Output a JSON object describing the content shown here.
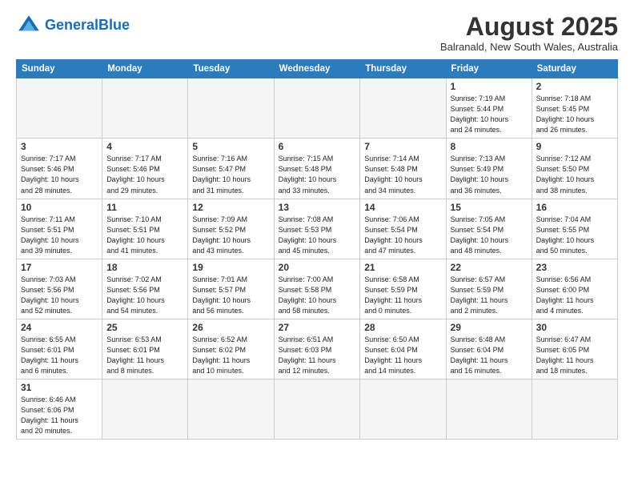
{
  "header": {
    "logo_general": "General",
    "logo_blue": "Blue",
    "month_year": "August 2025",
    "location": "Balranald, New South Wales, Australia"
  },
  "weekdays": [
    "Sunday",
    "Monday",
    "Tuesday",
    "Wednesday",
    "Thursday",
    "Friday",
    "Saturday"
  ],
  "weeks": [
    [
      {
        "day": "",
        "info": ""
      },
      {
        "day": "",
        "info": ""
      },
      {
        "day": "",
        "info": ""
      },
      {
        "day": "",
        "info": ""
      },
      {
        "day": "",
        "info": ""
      },
      {
        "day": "1",
        "info": "Sunrise: 7:19 AM\nSunset: 5:44 PM\nDaylight: 10 hours\nand 24 minutes."
      },
      {
        "day": "2",
        "info": "Sunrise: 7:18 AM\nSunset: 5:45 PM\nDaylight: 10 hours\nand 26 minutes."
      }
    ],
    [
      {
        "day": "3",
        "info": "Sunrise: 7:17 AM\nSunset: 5:46 PM\nDaylight: 10 hours\nand 28 minutes."
      },
      {
        "day": "4",
        "info": "Sunrise: 7:17 AM\nSunset: 5:46 PM\nDaylight: 10 hours\nand 29 minutes."
      },
      {
        "day": "5",
        "info": "Sunrise: 7:16 AM\nSunset: 5:47 PM\nDaylight: 10 hours\nand 31 minutes."
      },
      {
        "day": "6",
        "info": "Sunrise: 7:15 AM\nSunset: 5:48 PM\nDaylight: 10 hours\nand 33 minutes."
      },
      {
        "day": "7",
        "info": "Sunrise: 7:14 AM\nSunset: 5:48 PM\nDaylight: 10 hours\nand 34 minutes."
      },
      {
        "day": "8",
        "info": "Sunrise: 7:13 AM\nSunset: 5:49 PM\nDaylight: 10 hours\nand 36 minutes."
      },
      {
        "day": "9",
        "info": "Sunrise: 7:12 AM\nSunset: 5:50 PM\nDaylight: 10 hours\nand 38 minutes."
      }
    ],
    [
      {
        "day": "10",
        "info": "Sunrise: 7:11 AM\nSunset: 5:51 PM\nDaylight: 10 hours\nand 39 minutes."
      },
      {
        "day": "11",
        "info": "Sunrise: 7:10 AM\nSunset: 5:51 PM\nDaylight: 10 hours\nand 41 minutes."
      },
      {
        "day": "12",
        "info": "Sunrise: 7:09 AM\nSunset: 5:52 PM\nDaylight: 10 hours\nand 43 minutes."
      },
      {
        "day": "13",
        "info": "Sunrise: 7:08 AM\nSunset: 5:53 PM\nDaylight: 10 hours\nand 45 minutes."
      },
      {
        "day": "14",
        "info": "Sunrise: 7:06 AM\nSunset: 5:54 PM\nDaylight: 10 hours\nand 47 minutes."
      },
      {
        "day": "15",
        "info": "Sunrise: 7:05 AM\nSunset: 5:54 PM\nDaylight: 10 hours\nand 48 minutes."
      },
      {
        "day": "16",
        "info": "Sunrise: 7:04 AM\nSunset: 5:55 PM\nDaylight: 10 hours\nand 50 minutes."
      }
    ],
    [
      {
        "day": "17",
        "info": "Sunrise: 7:03 AM\nSunset: 5:56 PM\nDaylight: 10 hours\nand 52 minutes."
      },
      {
        "day": "18",
        "info": "Sunrise: 7:02 AM\nSunset: 5:56 PM\nDaylight: 10 hours\nand 54 minutes."
      },
      {
        "day": "19",
        "info": "Sunrise: 7:01 AM\nSunset: 5:57 PM\nDaylight: 10 hours\nand 56 minutes."
      },
      {
        "day": "20",
        "info": "Sunrise: 7:00 AM\nSunset: 5:58 PM\nDaylight: 10 hours\nand 58 minutes."
      },
      {
        "day": "21",
        "info": "Sunrise: 6:58 AM\nSunset: 5:59 PM\nDaylight: 11 hours\nand 0 minutes."
      },
      {
        "day": "22",
        "info": "Sunrise: 6:57 AM\nSunset: 5:59 PM\nDaylight: 11 hours\nand 2 minutes."
      },
      {
        "day": "23",
        "info": "Sunrise: 6:56 AM\nSunset: 6:00 PM\nDaylight: 11 hours\nand 4 minutes."
      }
    ],
    [
      {
        "day": "24",
        "info": "Sunrise: 6:55 AM\nSunset: 6:01 PM\nDaylight: 11 hours\nand 6 minutes."
      },
      {
        "day": "25",
        "info": "Sunrise: 6:53 AM\nSunset: 6:01 PM\nDaylight: 11 hours\nand 8 minutes."
      },
      {
        "day": "26",
        "info": "Sunrise: 6:52 AM\nSunset: 6:02 PM\nDaylight: 11 hours\nand 10 minutes."
      },
      {
        "day": "27",
        "info": "Sunrise: 6:51 AM\nSunset: 6:03 PM\nDaylight: 11 hours\nand 12 minutes."
      },
      {
        "day": "28",
        "info": "Sunrise: 6:50 AM\nSunset: 6:04 PM\nDaylight: 11 hours\nand 14 minutes."
      },
      {
        "day": "29",
        "info": "Sunrise: 6:48 AM\nSunset: 6:04 PM\nDaylight: 11 hours\nand 16 minutes."
      },
      {
        "day": "30",
        "info": "Sunrise: 6:47 AM\nSunset: 6:05 PM\nDaylight: 11 hours\nand 18 minutes."
      }
    ],
    [
      {
        "day": "31",
        "info": "Sunrise: 6:46 AM\nSunset: 6:06 PM\nDaylight: 11 hours\nand 20 minutes."
      },
      {
        "day": "",
        "info": ""
      },
      {
        "day": "",
        "info": ""
      },
      {
        "day": "",
        "info": ""
      },
      {
        "day": "",
        "info": ""
      },
      {
        "day": "",
        "info": ""
      },
      {
        "day": "",
        "info": ""
      }
    ]
  ]
}
